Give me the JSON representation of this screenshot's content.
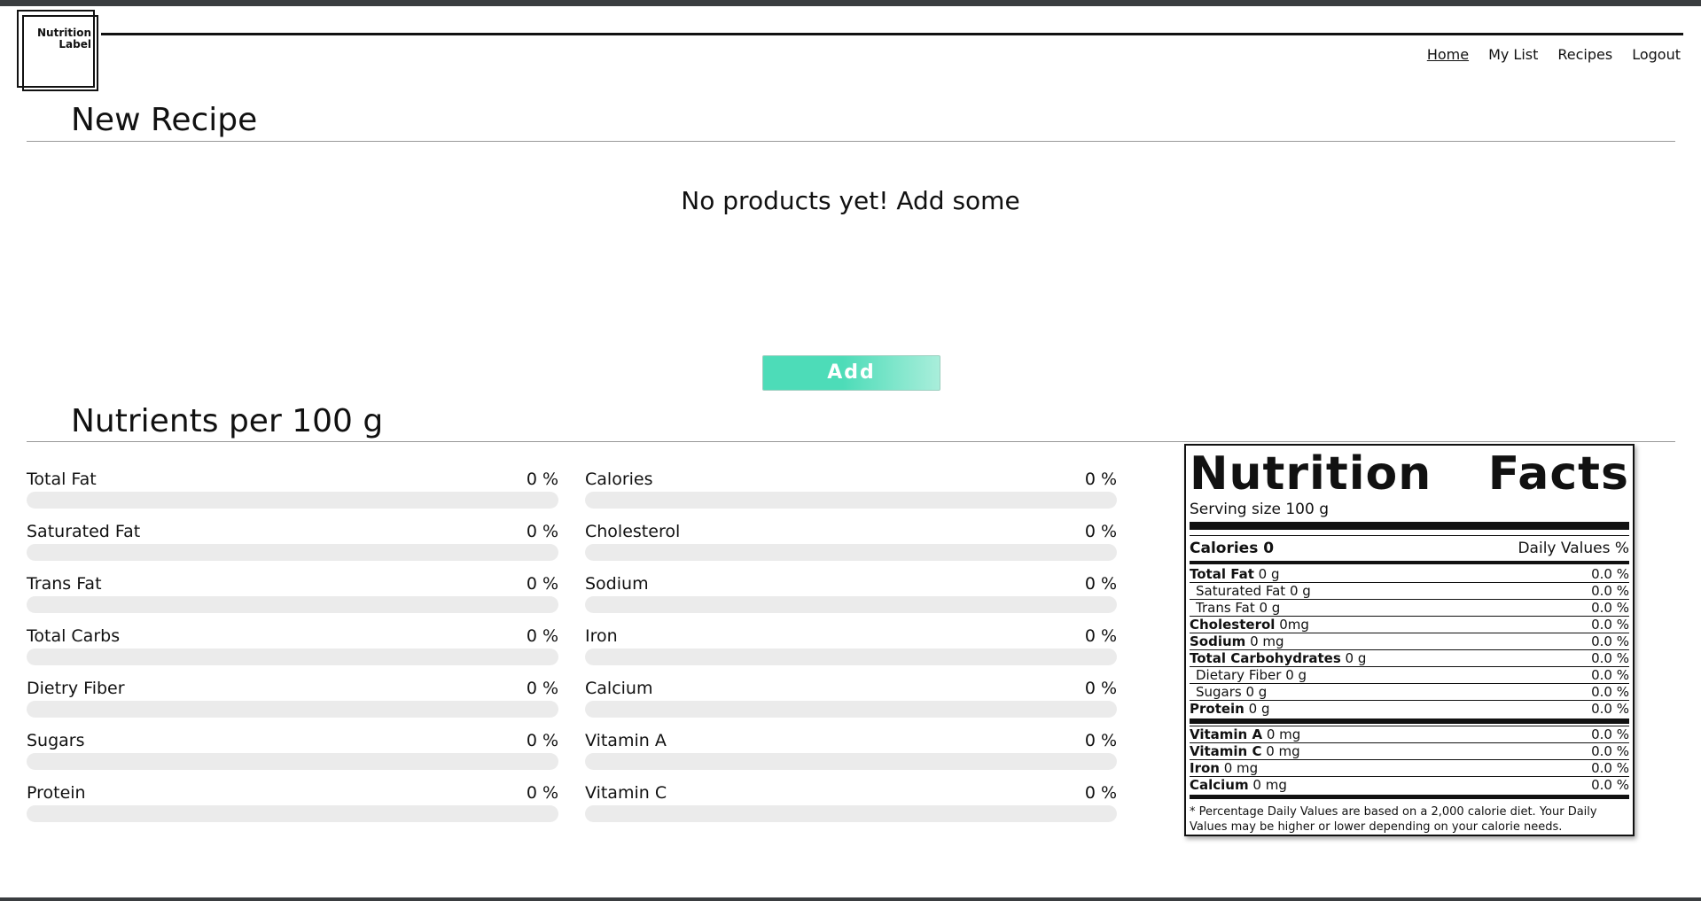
{
  "logo": {
    "line1": "Nutrition",
    "line2": "Label"
  },
  "nav": {
    "home": "Home",
    "my_list": "My List",
    "recipes": "Recipes",
    "logout": "Logout"
  },
  "recipe": {
    "title": "New Recipe",
    "empty_message": "No products yet! Add some",
    "add_label": "Add"
  },
  "nutrients": {
    "title": "Nutrients per 100 g",
    "left": [
      {
        "label": "Total Fat",
        "pct": "0 %",
        "fraction": 0
      },
      {
        "label": "Saturated Fat",
        "pct": "0 %",
        "fraction": 0
      },
      {
        "label": "Trans Fat",
        "pct": "0 %",
        "fraction": 0
      },
      {
        "label": "Total Carbs",
        "pct": "0 %",
        "fraction": 0
      },
      {
        "label": "Dietry Fiber",
        "pct": "0 %",
        "fraction": 0
      },
      {
        "label": "Sugars",
        "pct": "0 %",
        "fraction": 0
      },
      {
        "label": "Protein",
        "pct": "0 %",
        "fraction": 0
      }
    ],
    "right": [
      {
        "label": "Calories",
        "pct": "0 %",
        "fraction": 0
      },
      {
        "label": "Cholesterol",
        "pct": "0 %",
        "fraction": 0
      },
      {
        "label": "Sodium",
        "pct": "0 %",
        "fraction": 0
      },
      {
        "label": "Iron",
        "pct": "0 %",
        "fraction": 0
      },
      {
        "label": "Calcium",
        "pct": "0 %",
        "fraction": 0
      },
      {
        "label": "Vitamin A",
        "pct": "0 %",
        "fraction": 0
      },
      {
        "label": "Vitamin C",
        "pct": "0 %",
        "fraction": 0
      }
    ]
  },
  "facts": {
    "title_left": "Nutrition",
    "title_right": "Facts",
    "serving": "Serving size 100 g",
    "calories_label": "Calories 0",
    "daily_values_label": "Daily Values %",
    "rows": [
      {
        "name": "Total Fat",
        "amount": " 0 g",
        "pct": "0.0 %"
      },
      {
        "name": "Saturated Fat 0 g",
        "amount": "",
        "pct": "0.0 %"
      },
      {
        "name": "Trans Fat 0 g",
        "amount": "",
        "pct": "0.0 %"
      },
      {
        "name": "Cholesterol",
        "amount": " 0mg",
        "pct": "0.0 %"
      },
      {
        "name": "Sodium",
        "amount": " 0 mg",
        "pct": "0.0 %"
      },
      {
        "name": "Total Carbohydrates",
        "amount": " 0 g",
        "pct": "0.0 %"
      },
      {
        "name": "Dietary Fiber 0 g",
        "amount": "",
        "pct": "0.0 %"
      },
      {
        "name": "Sugars 0 g",
        "amount": "",
        "pct": "0.0 %"
      },
      {
        "name": "Protein",
        "amount": " 0 g",
        "pct": "0.0 %"
      },
      {
        "name": "Vitamin A",
        "amount": " 0 mg",
        "pct": "0.0 %"
      },
      {
        "name": "Vitamin C",
        "amount": " 0 mg",
        "pct": "0.0 %"
      },
      {
        "name": "Iron",
        "amount": " 0 mg",
        "pct": "0.0 %"
      },
      {
        "name": "Calcium",
        "amount": " 0 mg",
        "pct": "0.0 %"
      }
    ],
    "footnote": "* Percentage Daily Values are based on a 2,000 calorie diet. Your Daily Values may be higher or lower depending on your calorie needs."
  },
  "colors": {
    "accent": "#4ddcb8",
    "track": "#ebebeb",
    "chrome": "#3a3d40"
  }
}
